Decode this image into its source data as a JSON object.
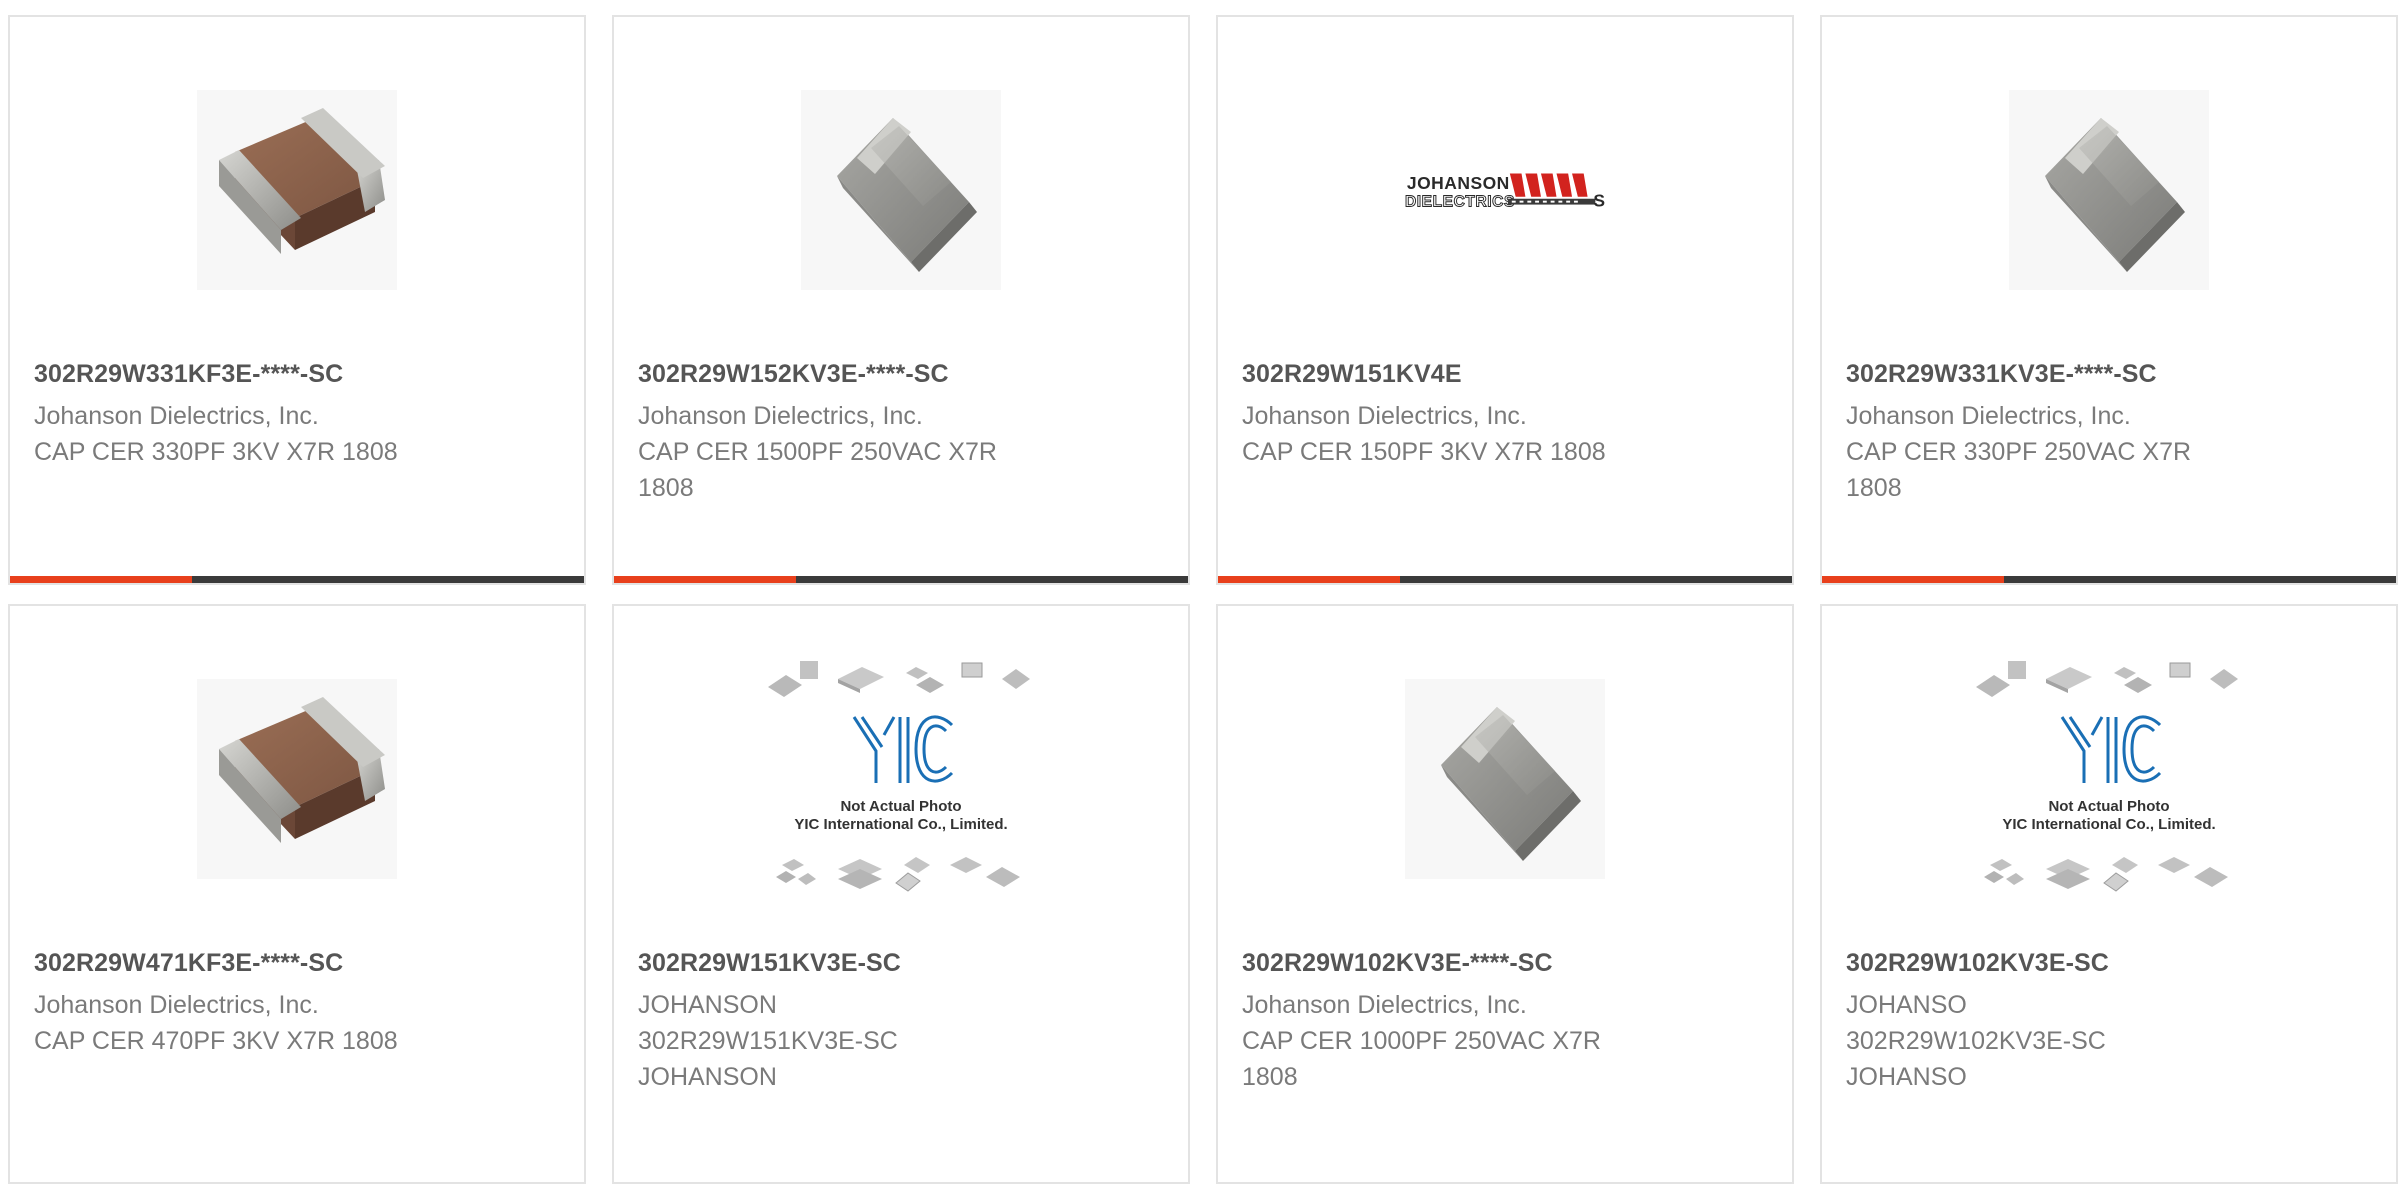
{
  "colors": {
    "accent": "#e8401c",
    "bar": "#3a3a3a",
    "border": "#e3e3e3",
    "part_text": "#555555",
    "detail_text": "#7a7a7a"
  },
  "products": [
    {
      "part_number": "302R29W331KF3E-****-SC",
      "manufacturer": "Johanson Dielectrics, Inc.",
      "description_line1": "CAP CER 330PF 3KV X7R 1808",
      "description_line2": "",
      "image_icon": "brown-chip-capacitor-image"
    },
    {
      "part_number": "302R29W152KV3E-****-SC",
      "manufacturer": "Johanson Dielectrics, Inc.",
      "description_line1": "CAP CER 1500PF 250VAC X7R",
      "description_line2": "1808",
      "image_icon": "gray-chip-capacitor-image"
    },
    {
      "part_number": "302R29W151KV4E",
      "manufacturer": "Johanson Dielectrics, Inc.",
      "description_line1": "CAP CER 150PF 3KV X7R 1808",
      "description_line2": "",
      "image_icon": "johanson-dielectrics-logo",
      "logo_text_line1": "JOHANSON",
      "logo_text_line2": "DIELECTRICS"
    },
    {
      "part_number": "302R29W331KV3E-****-SC",
      "manufacturer": "Johanson Dielectrics, Inc.",
      "description_line1": "CAP CER 330PF 250VAC X7R",
      "description_line2": "1808",
      "image_icon": "gray-chip-capacitor-image"
    },
    {
      "part_number": "302R29W471KF3E-****-SC",
      "manufacturer": "Johanson Dielectrics, Inc.",
      "description_line1": "CAP CER 470PF 3KV X7R 1808",
      "description_line2": "",
      "image_icon": "brown-chip-capacitor-image"
    },
    {
      "part_number": "302R29W151KV3E-SC",
      "manufacturer": "JOHANSON",
      "description_line1": "302R29W151KV3E-SC",
      "description_line2": "JOHANSON",
      "image_icon": "yic-not-actual-photo-image",
      "placeholder_line1": "Not Actual Photo",
      "placeholder_line2": "YIC International Co., Limited."
    },
    {
      "part_number": "302R29W102KV3E-****-SC",
      "manufacturer": "Johanson Dielectrics, Inc.",
      "description_line1": "CAP CER 1000PF 250VAC X7R",
      "description_line2": "1808",
      "image_icon": "gray-chip-capacitor-image"
    },
    {
      "part_number": "302R29W102KV3E-SC",
      "manufacturer": "JOHANSO",
      "description_line1": "302R29W102KV3E-SC",
      "description_line2": "JOHANSO",
      "image_icon": "yic-not-actual-photo-image",
      "placeholder_line1": "Not Actual Photo",
      "placeholder_line2": "YIC International Co., Limited."
    }
  ]
}
